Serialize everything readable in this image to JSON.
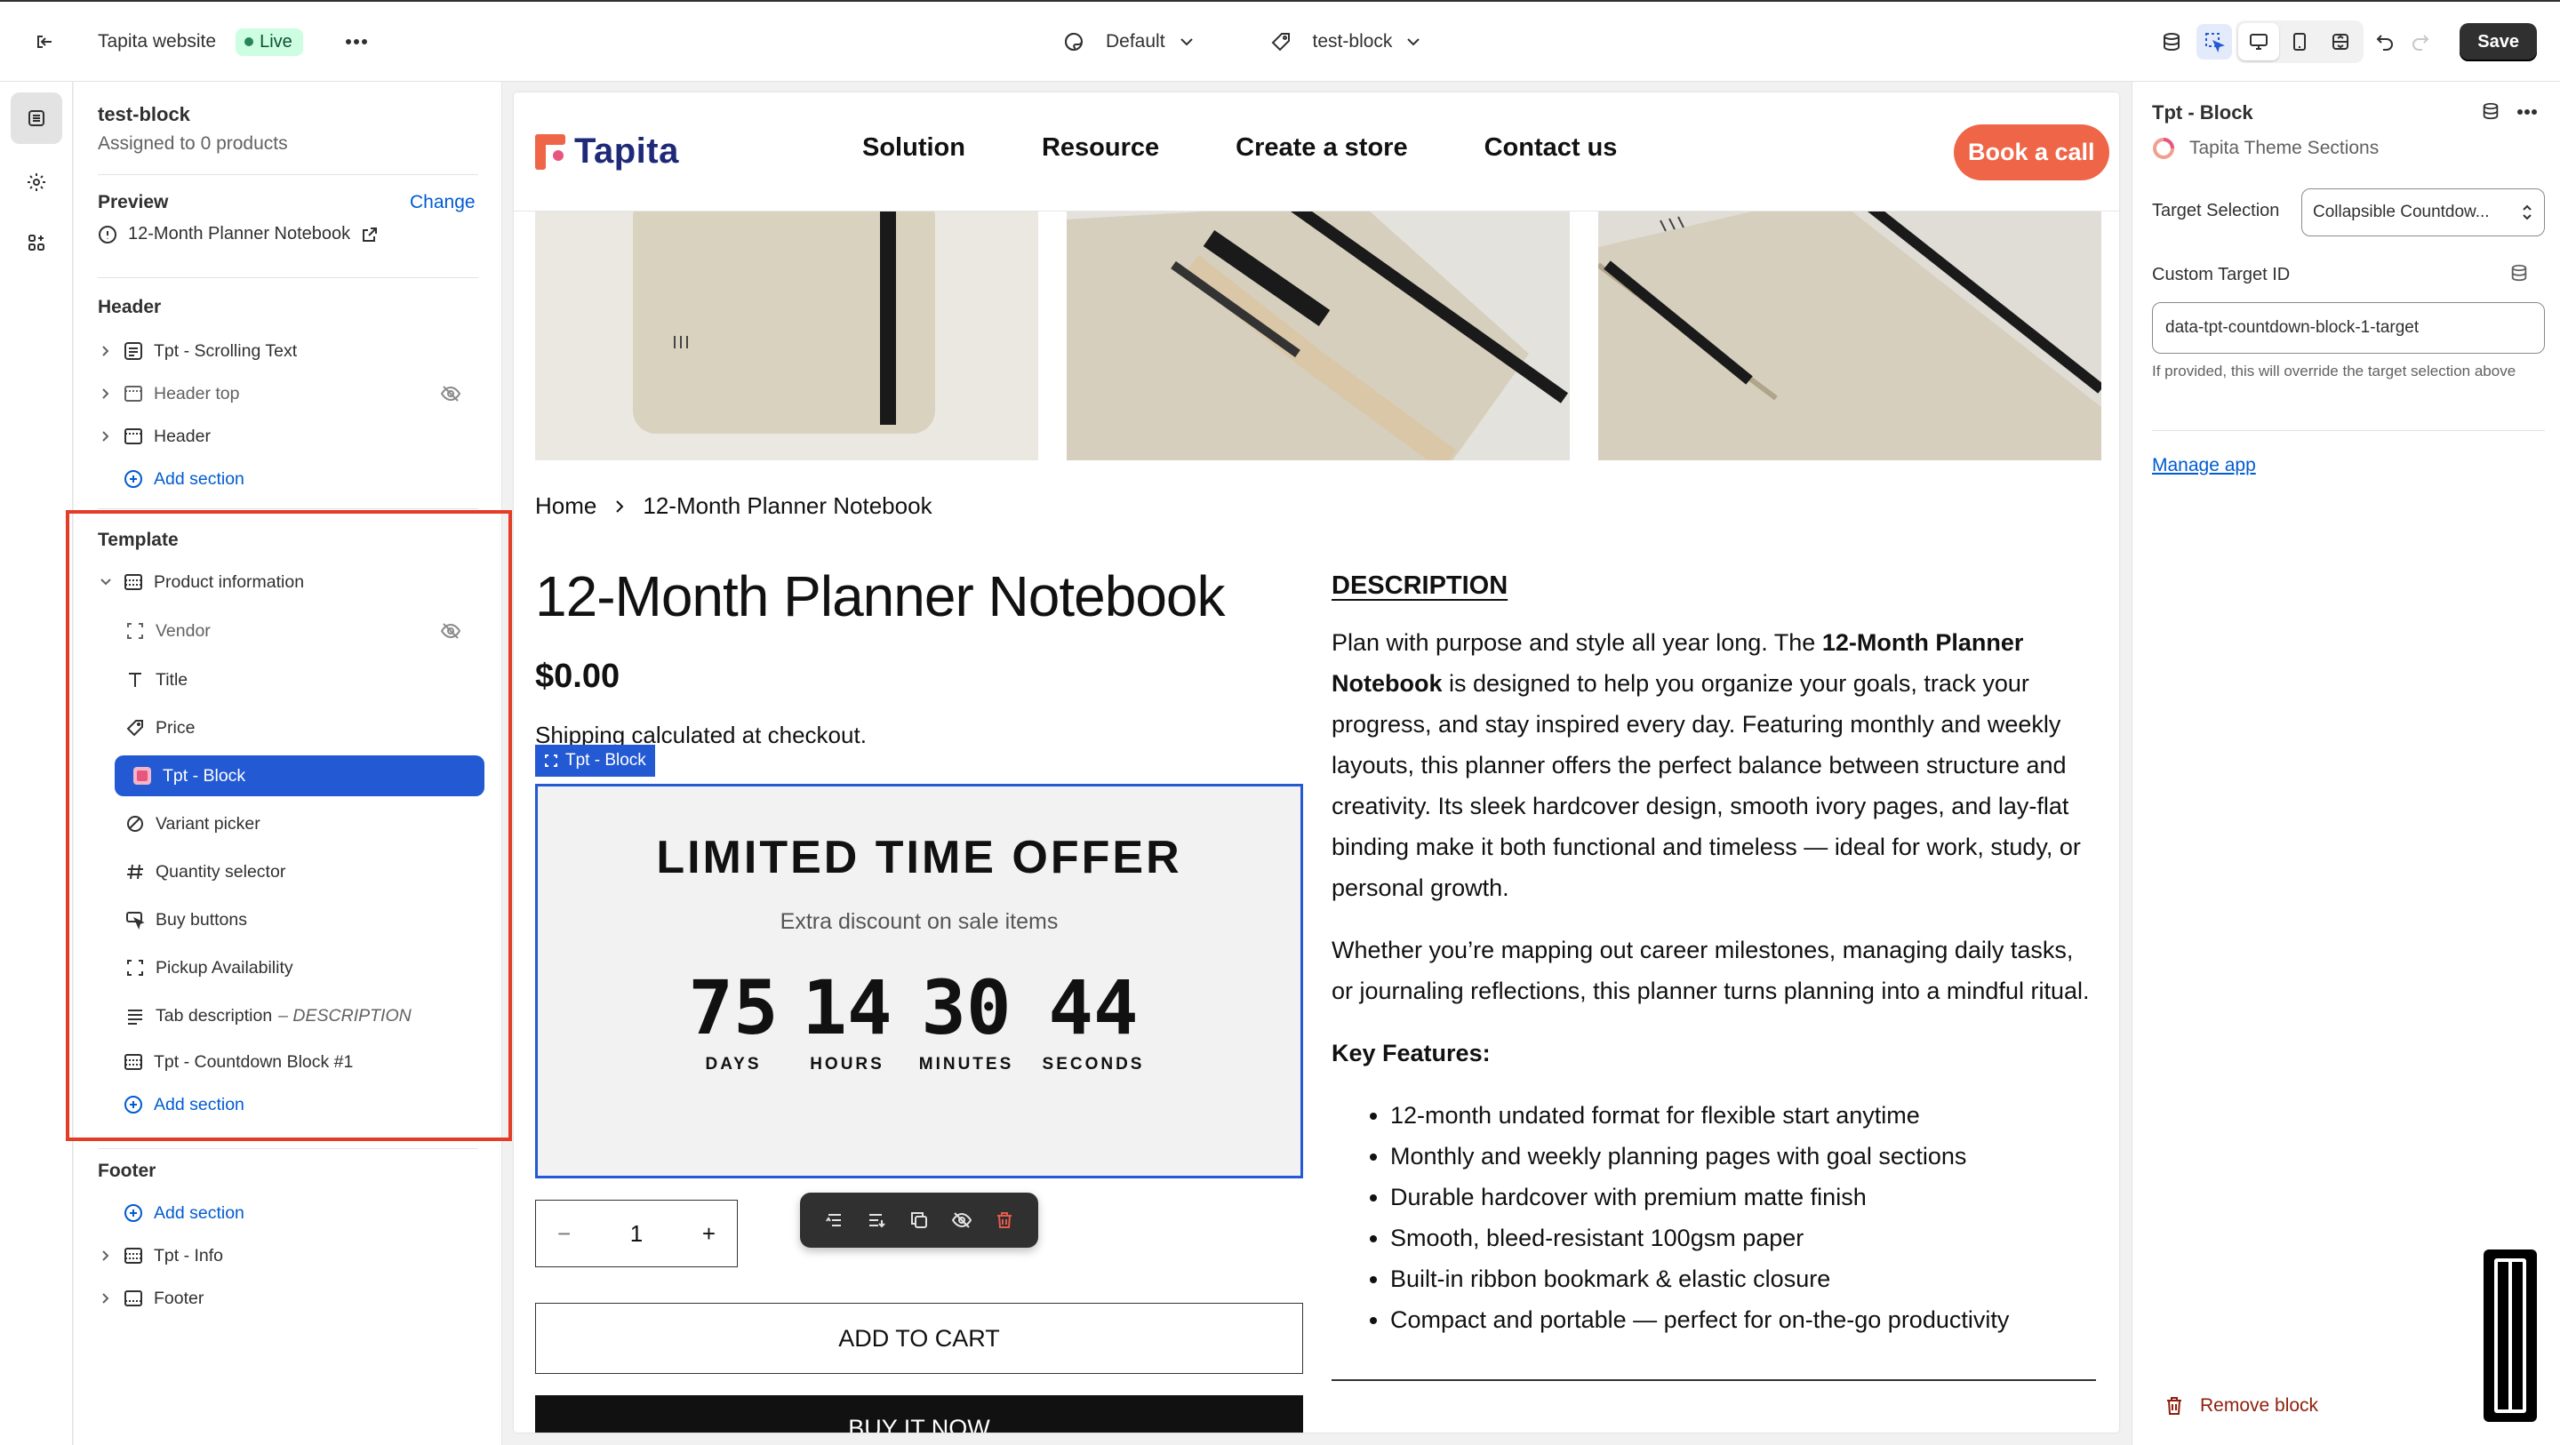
{
  "topbar": {
    "store_name": "Tapita website",
    "status_badge": "Live",
    "theme_dropdown": "Default",
    "template_dropdown": "test-block",
    "save_label": "Save"
  },
  "left_panel": {
    "template_name": "test-block",
    "assigned": "Assigned to 0 products",
    "preview_label": "Preview",
    "change_label": "Change",
    "preview_product": "12-Month Planner Notebook",
    "header_section": {
      "title": "Header",
      "items": [
        {
          "label": "Tpt - Scrolling Text"
        },
        {
          "label": "Header top"
        },
        {
          "label": "Header"
        }
      ],
      "add_label": "Add section"
    },
    "template_section": {
      "title": "Template",
      "group_label": "Product information",
      "blocks": [
        {
          "label": "Vendor"
        },
        {
          "label": "Title"
        },
        {
          "label": "Price"
        },
        {
          "label": "Tpt - Block"
        },
        {
          "label": "Variant picker"
        },
        {
          "label": "Quantity selector"
        },
        {
          "label": "Buy buttons"
        },
        {
          "label": "Pickup Availability"
        },
        {
          "label": "Tab description",
          "suffix": "– DESCRIPTION"
        }
      ],
      "countdown_label": "Tpt - Countdown Block #1",
      "add_label": "Add section"
    },
    "footer_section": {
      "title": "Footer",
      "add_label": "Add section",
      "items": [
        {
          "label": "Tpt - Info"
        },
        {
          "label": "Footer"
        }
      ]
    }
  },
  "site": {
    "logo_text": "Tapita",
    "nav": [
      "Solution",
      "Resource",
      "Create a store",
      "Contact us"
    ],
    "cta": "Book a call",
    "breadcrumb": {
      "home": "Home",
      "current": "12-Month Planner Notebook"
    },
    "product_title": "12-Month Planner Notebook",
    "price": "$0.00",
    "shipping": "Shipping calculated at checkout.",
    "block_tag": "Tpt - Block",
    "offer": {
      "title": "LIMITED TIME OFFER",
      "subtitle": "Extra discount on sale items",
      "countdown": [
        {
          "value": "75",
          "label": "DAYS"
        },
        {
          "value": "14",
          "label": "HOURS"
        },
        {
          "value": "30",
          "label": "MINUTES"
        },
        {
          "value": "44",
          "label": "SECONDS"
        }
      ]
    },
    "quantity": {
      "minus": "−",
      "value": "1",
      "plus": "+"
    },
    "add_to_cart": "ADD TO CART",
    "buy_now": "BUY IT NOW",
    "description": {
      "heading": "DESCRIPTION",
      "p1_a": "Plan with purpose and style all year long. The ",
      "p1_bold": "12-Month Planner Notebook",
      "p1_b": " is designed to help you organize your goals, track your progress, and stay inspired every day. Featuring monthly and weekly layouts, this planner offers the perfect balance between structure and creativity. Its sleek hardcover design, smooth ivory pages, and lay-flat binding make it both functional and timeless — ideal for work, study, or personal growth.",
      "p2": "Whether you’re mapping out career milestones, managing daily tasks, or journaling reflections, this planner turns planning into a mindful ritual.",
      "features_heading": "Key Features:",
      "features": [
        "12-month undated format for flexible start anytime",
        "Monthly and weekly planning pages with goal sections",
        "Durable hardcover with premium matte finish",
        "Smooth, bleed-resistant 100gsm paper",
        "Built-in ribbon bookmark & elastic closure",
        "Compact and portable — perfect for on-the-go productivity"
      ]
    }
  },
  "right_panel": {
    "title": "Tpt - Block",
    "app_name": "Tapita Theme Sections",
    "target_selection_label": "Target Selection",
    "target_selection_value": "Collapsible Countdow...",
    "custom_target_label": "Custom Target ID",
    "custom_target_value": "data-tpt-countdown-block-1-target",
    "help_text": "If provided, this will override the target selection above",
    "manage_app": "Manage app",
    "remove_block": "Remove block"
  },
  "colors": {
    "accent": "#2359d3",
    "highlight_frame": "#e53c27",
    "cta": "#ef6547",
    "live_badge": "#cdfee1"
  }
}
